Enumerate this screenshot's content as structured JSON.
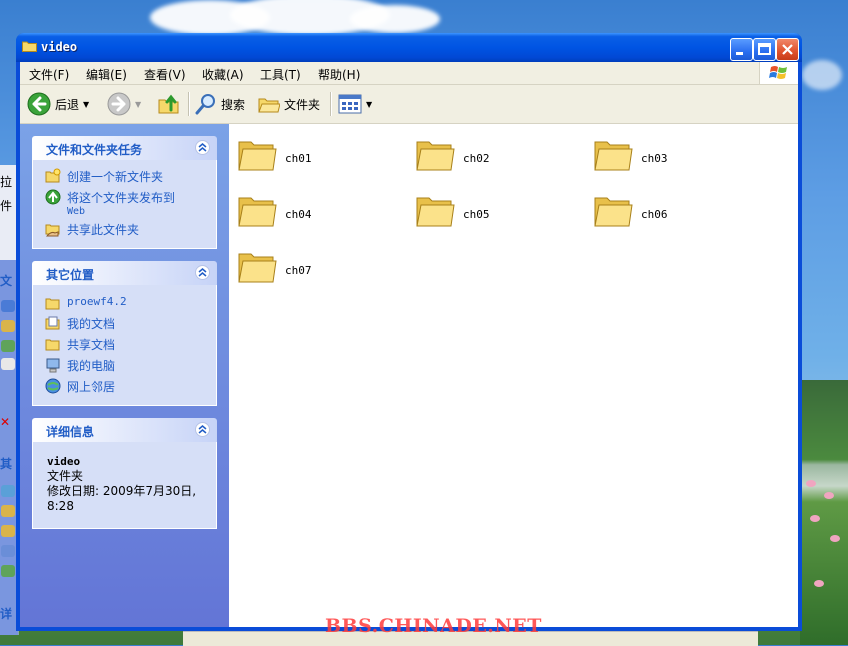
{
  "window": {
    "title": "video",
    "buttons": [
      "minimize",
      "maximize",
      "close"
    ]
  },
  "menubar": {
    "items": [
      "文件(F)",
      "编辑(E)",
      "查看(V)",
      "收藏(A)",
      "工具(T)",
      "帮助(H)"
    ]
  },
  "toolbar": {
    "back_label": "后退",
    "search_label": "搜索",
    "folders_label": "文件夹"
  },
  "tasks_panel": {
    "title": "文件和文件夹任务",
    "items": [
      {
        "label": "创建一个新文件夹",
        "icon": "new-folder-icon"
      },
      {
        "label": "将这个文件夹发布到",
        "sub": "Web",
        "icon": "publish-web-icon"
      },
      {
        "label": "共享此文件夹",
        "icon": "share-folder-icon"
      }
    ]
  },
  "places_panel": {
    "title": "其它位置",
    "items": [
      {
        "label": "proewf4.2",
        "icon": "folder-icon"
      },
      {
        "label": "我的文档",
        "icon": "my-documents-icon"
      },
      {
        "label": "共享文档",
        "icon": "shared-documents-icon"
      },
      {
        "label": "我的电脑",
        "icon": "my-computer-icon"
      },
      {
        "label": "网上邻居",
        "icon": "network-places-icon"
      }
    ]
  },
  "details_panel": {
    "title": "详细信息",
    "name": "video",
    "type": "文件夹",
    "modified": "修改日期: 2009年7月30日,",
    "time": "8:28"
  },
  "folders": [
    "ch01",
    "ch02",
    "ch03",
    "ch04",
    "ch05",
    "ch06",
    "ch07"
  ],
  "watermark": "BBS.CHINADE.NET",
  "colors": {
    "title_blue": "#0054e3",
    "panel_link": "#215dc6",
    "pane_gradient_top": "#7ba2e7",
    "watermark": "#ff3c3c"
  }
}
